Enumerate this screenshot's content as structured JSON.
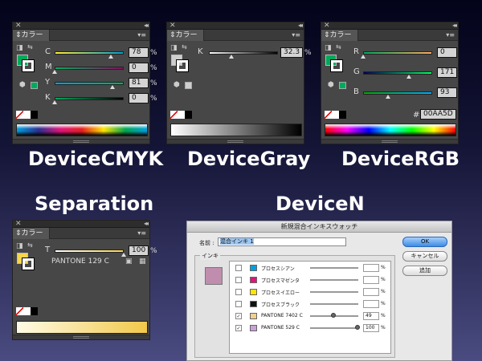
{
  "panel_title": "カラー",
  "colors": {
    "green_fill": "#00AA5D",
    "gray_fill": "#CECECE",
    "separation_fill": "#F7D54F",
    "ink_preview": "#C18DAF"
  },
  "cmyk": {
    "caption": "DeviceCMYK",
    "channels": [
      {
        "label": "C",
        "value": "78",
        "unit": "%",
        "level": 0.78
      },
      {
        "label": "M",
        "value": "0",
        "unit": "%",
        "level": 0.0
      },
      {
        "label": "Y",
        "value": "81",
        "unit": "%",
        "level": 0.81
      },
      {
        "label": "K",
        "value": "0",
        "unit": "%",
        "level": 0.0
      }
    ]
  },
  "gray": {
    "caption": "DeviceGray",
    "channels": [
      {
        "label": "K",
        "value": "32.3",
        "unit": "%",
        "level": 0.323
      }
    ]
  },
  "rgb": {
    "caption": "DeviceRGB",
    "channels": [
      {
        "label": "R",
        "value": "0",
        "level": 0.0
      },
      {
        "label": "G",
        "value": "171",
        "level": 0.67
      },
      {
        "label": "B",
        "value": "93",
        "level": 0.365
      }
    ],
    "hex_label": "#",
    "hex_value": "00AA5D"
  },
  "separation": {
    "caption": "Separation",
    "tint_label": "T",
    "tint_value": "100",
    "unit": "%",
    "level": 1.0,
    "ink_name": "PANTONE 129 C"
  },
  "devicen": {
    "caption": "DeviceN",
    "dialog_title": "新規混合インキスウォッチ",
    "name_label": "名前 :",
    "name_value": "混合インキ 1",
    "ink_group_label": "インキ",
    "buttons": {
      "ok": "OK",
      "cancel": "キャンセル",
      "add": "追加"
    },
    "inks": [
      {
        "name": "プロセスシアン",
        "value": "",
        "color": "#00A0E0",
        "checked": false,
        "level": 0
      },
      {
        "name": "プロセスマゼンタ",
        "value": "",
        "color": "#E0157B",
        "checked": false,
        "level": 0
      },
      {
        "name": "プロセスイエロー",
        "value": "",
        "color": "#FFE500",
        "checked": false,
        "level": 0
      },
      {
        "name": "プロセスブラック",
        "value": "",
        "color": "#111111",
        "checked": false,
        "level": 0
      },
      {
        "name": "PANTONE 7402 C",
        "value": "49",
        "color": "#F1D08E",
        "checked": true,
        "level": 0.49
      },
      {
        "name": "PANTONE 529 C",
        "value": "100",
        "color": "#C8A2D4",
        "checked": true,
        "level": 1.0
      }
    ],
    "unit": "%"
  }
}
